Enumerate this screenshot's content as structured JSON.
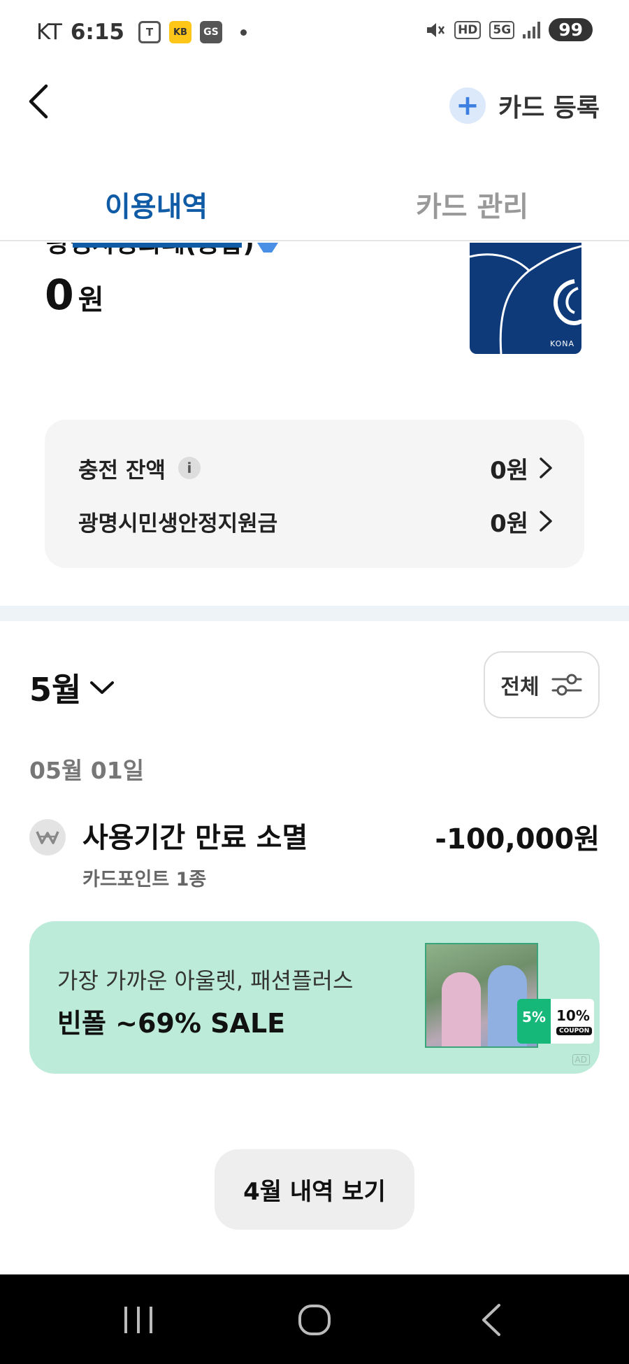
{
  "status_bar": {
    "carrier": "KT",
    "time": "6:15",
    "apps": [
      "T",
      "KB",
      "GS"
    ],
    "hd": "HD",
    "network": "5G",
    "battery": "99"
  },
  "header": {
    "back_icon": "chevron-left-icon",
    "register_plus": "+",
    "register_label": "카드 등록"
  },
  "tabs": {
    "usage": "이용내역",
    "manage": "카드 관리"
  },
  "card": {
    "name_partial": "광명사랑화폐(종합)",
    "balance_amount": "0",
    "balance_unit": "원",
    "brand": "KONA",
    "card_color": "#0e3a7a"
  },
  "balances": {
    "rows": [
      {
        "label": "충전 잔액",
        "info": "i",
        "value": "0원"
      },
      {
        "label": "광명시민생안정지원금",
        "value": "0원"
      }
    ]
  },
  "filter": {
    "month": "5월",
    "scope": "전체"
  },
  "transactions": {
    "date": "05월 01일",
    "items": [
      {
        "title": "사용기간 만료 소멸",
        "subtitle": "카드포인트 1종",
        "amount": "-100,000원",
        "icon": "won-icon"
      }
    ]
  },
  "ad": {
    "line1": "가장 가까운 아울렛, 패션플러스",
    "line2": "빈폴 ~69% SALE",
    "coupon_5": "5%",
    "coupon_10": "10%",
    "coupon_word": "COUPON",
    "tag": "AD",
    "bg_color": "#bcebd9"
  },
  "footer": {
    "prev_month_button": "4월 내역 보기"
  },
  "colors": {
    "accent": "#0f5ba5",
    "plus_bg": "#dbe9fb"
  }
}
